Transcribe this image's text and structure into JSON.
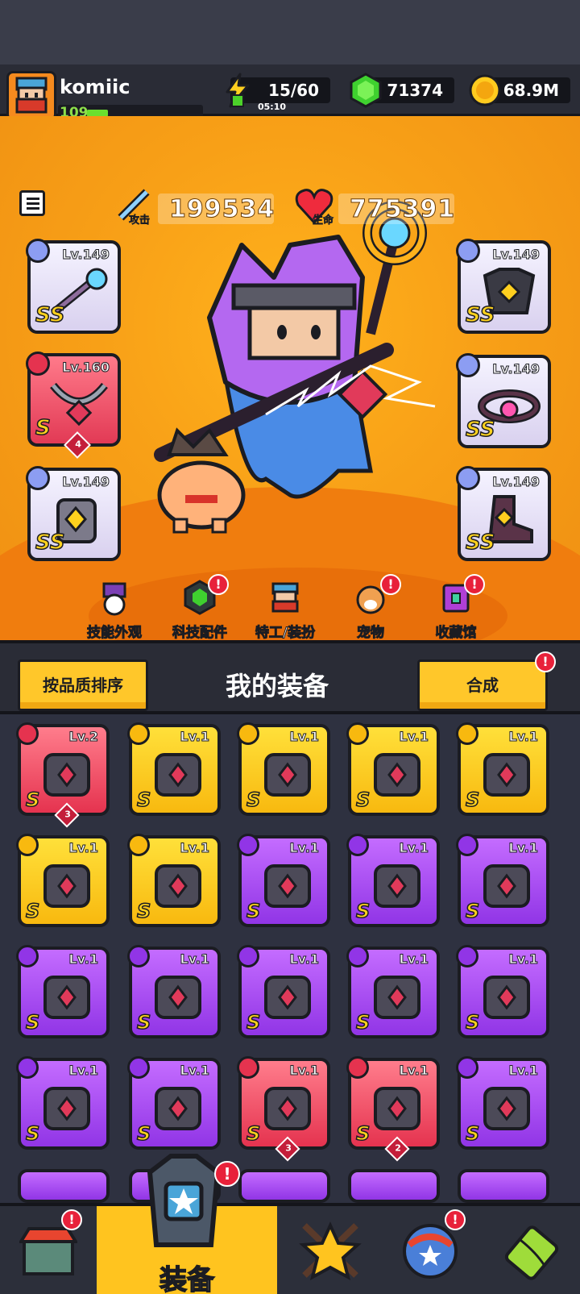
{
  "player": {
    "name": "komiic",
    "level": "109"
  },
  "resources": {
    "energy": "15/60",
    "energy_timer": "05:10",
    "gems": "71374",
    "gold": "68.9M"
  },
  "stats": {
    "attack_value": "199534",
    "attack_label": "攻击",
    "hp_value": "775391",
    "hp_label": "生命"
  },
  "equipped": [
    {
      "level": "Lv.149",
      "quality": "SS"
    },
    {
      "level": "Lv.160",
      "quality": "S",
      "count": "4"
    },
    {
      "level": "Lv.149",
      "quality": "SS"
    },
    {
      "level": "Lv.149",
      "quality": "SS"
    },
    {
      "level": "Lv.149",
      "quality": "SS"
    },
    {
      "level": "Lv.149",
      "quality": "SS"
    }
  ],
  "sub_menu": [
    {
      "label": "技能外观"
    },
    {
      "label": "科技配件"
    },
    {
      "label": "特工/装扮"
    },
    {
      "label": "宠物"
    },
    {
      "label": "收藏馆"
    }
  ],
  "panel": {
    "sort_label": "按品质排序",
    "title": "我的装备",
    "merge_label": "合成"
  },
  "inventory": [
    {
      "level": "Lv.2",
      "quality": "S",
      "count": "3"
    },
    {
      "level": "Lv.1",
      "quality": "S"
    },
    {
      "level": "Lv.1",
      "quality": "S"
    },
    {
      "level": "Lv.1",
      "quality": "S"
    },
    {
      "level": "Lv.1",
      "quality": "S"
    },
    {
      "level": "Lv.1",
      "quality": "S"
    },
    {
      "level": "Lv.1",
      "quality": "S"
    },
    {
      "level": "Lv.1",
      "quality": "S"
    },
    {
      "level": "Lv.1",
      "quality": "S"
    },
    {
      "level": "Lv.1",
      "quality": "S"
    },
    {
      "level": "Lv.1",
      "quality": "S"
    },
    {
      "level": "Lv.1",
      "quality": "S"
    },
    {
      "level": "Lv.1",
      "quality": "S"
    },
    {
      "level": "Lv.1",
      "quality": "S"
    },
    {
      "level": "Lv.1",
      "quality": "S"
    },
    {
      "level": "Lv.1",
      "quality": "S"
    },
    {
      "level": "Lv.1",
      "quality": "S"
    },
    {
      "level": "Lv.1",
      "quality": "S",
      "count": "3"
    },
    {
      "level": "Lv.1",
      "quality": "S",
      "count": "2"
    },
    {
      "level": "Lv.1",
      "quality": "S"
    }
  ],
  "nav": {
    "active_label": "装备",
    "alert": "!"
  },
  "colors": {
    "orange_bg": "#f8a017",
    "panel_bg": "#2e3140",
    "yellow": "#ffc72a",
    "purple": "#9135e6",
    "red": "#e5334f"
  }
}
